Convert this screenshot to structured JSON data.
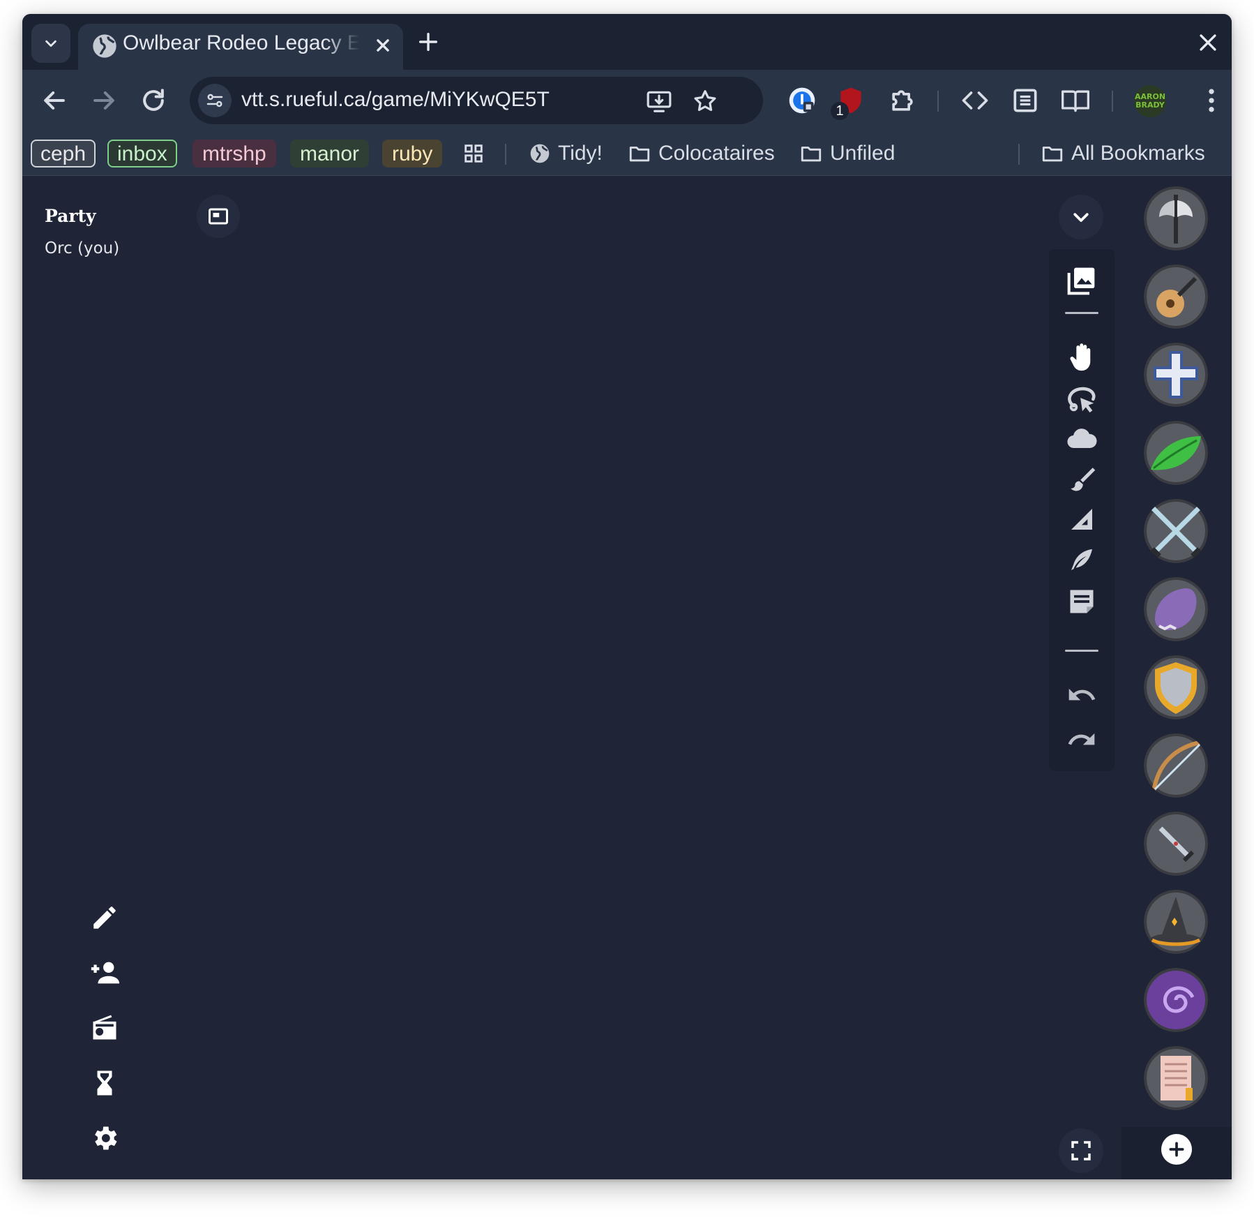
{
  "browser": {
    "tab_title": "Owlbear Rodeo Legacy E",
    "url": "vtt.s.rueful.ca/game/MiYKwQE5T",
    "extension_badge": "1",
    "profile_text": "AARON BRADY"
  },
  "bookmarks": {
    "chips": [
      {
        "label": "ceph",
        "color": "#e8e8e8",
        "bg": "#3b4250",
        "border": "#cfd3da"
      },
      {
        "label": "inbox",
        "color": "#c7f0c9",
        "bg": "#2a3a33",
        "border": "#7fcf8a"
      },
      {
        "label": "mtrshp",
        "color": "#f4c9d6",
        "bg": "#4a2f40",
        "border": "#4a2f40"
      },
      {
        "label": "manor",
        "color": "#d6f0cf",
        "bg": "#2f3f35",
        "border": "#2f3f35"
      },
      {
        "label": "ruby",
        "color": "#fbe7b6",
        "bg": "#4b4331",
        "border": "#4b4331"
      }
    ],
    "items": [
      "Tidy!",
      "Colocataires",
      "Unfiled"
    ],
    "all": "All Bookmarks"
  },
  "party": {
    "title": "Party",
    "members": [
      "Orc (you)"
    ]
  },
  "tokens": [
    {
      "name": "axe-token",
      "icon": "axe"
    },
    {
      "name": "lute-token",
      "icon": "lute"
    },
    {
      "name": "cleric-token",
      "icon": "cross"
    },
    {
      "name": "druid-token",
      "icon": "leaf"
    },
    {
      "name": "fighter-token",
      "icon": "crossed-swords"
    },
    {
      "name": "monk-token",
      "icon": "fist"
    },
    {
      "name": "paladin-token",
      "icon": "shield"
    },
    {
      "name": "ranger-token",
      "icon": "bow"
    },
    {
      "name": "rogue-token",
      "icon": "dagger"
    },
    {
      "name": "wizard-token",
      "icon": "wizard-hat"
    },
    {
      "name": "warlock-token",
      "icon": "vortex"
    },
    {
      "name": "scroll-token",
      "icon": "scroll"
    }
  ]
}
